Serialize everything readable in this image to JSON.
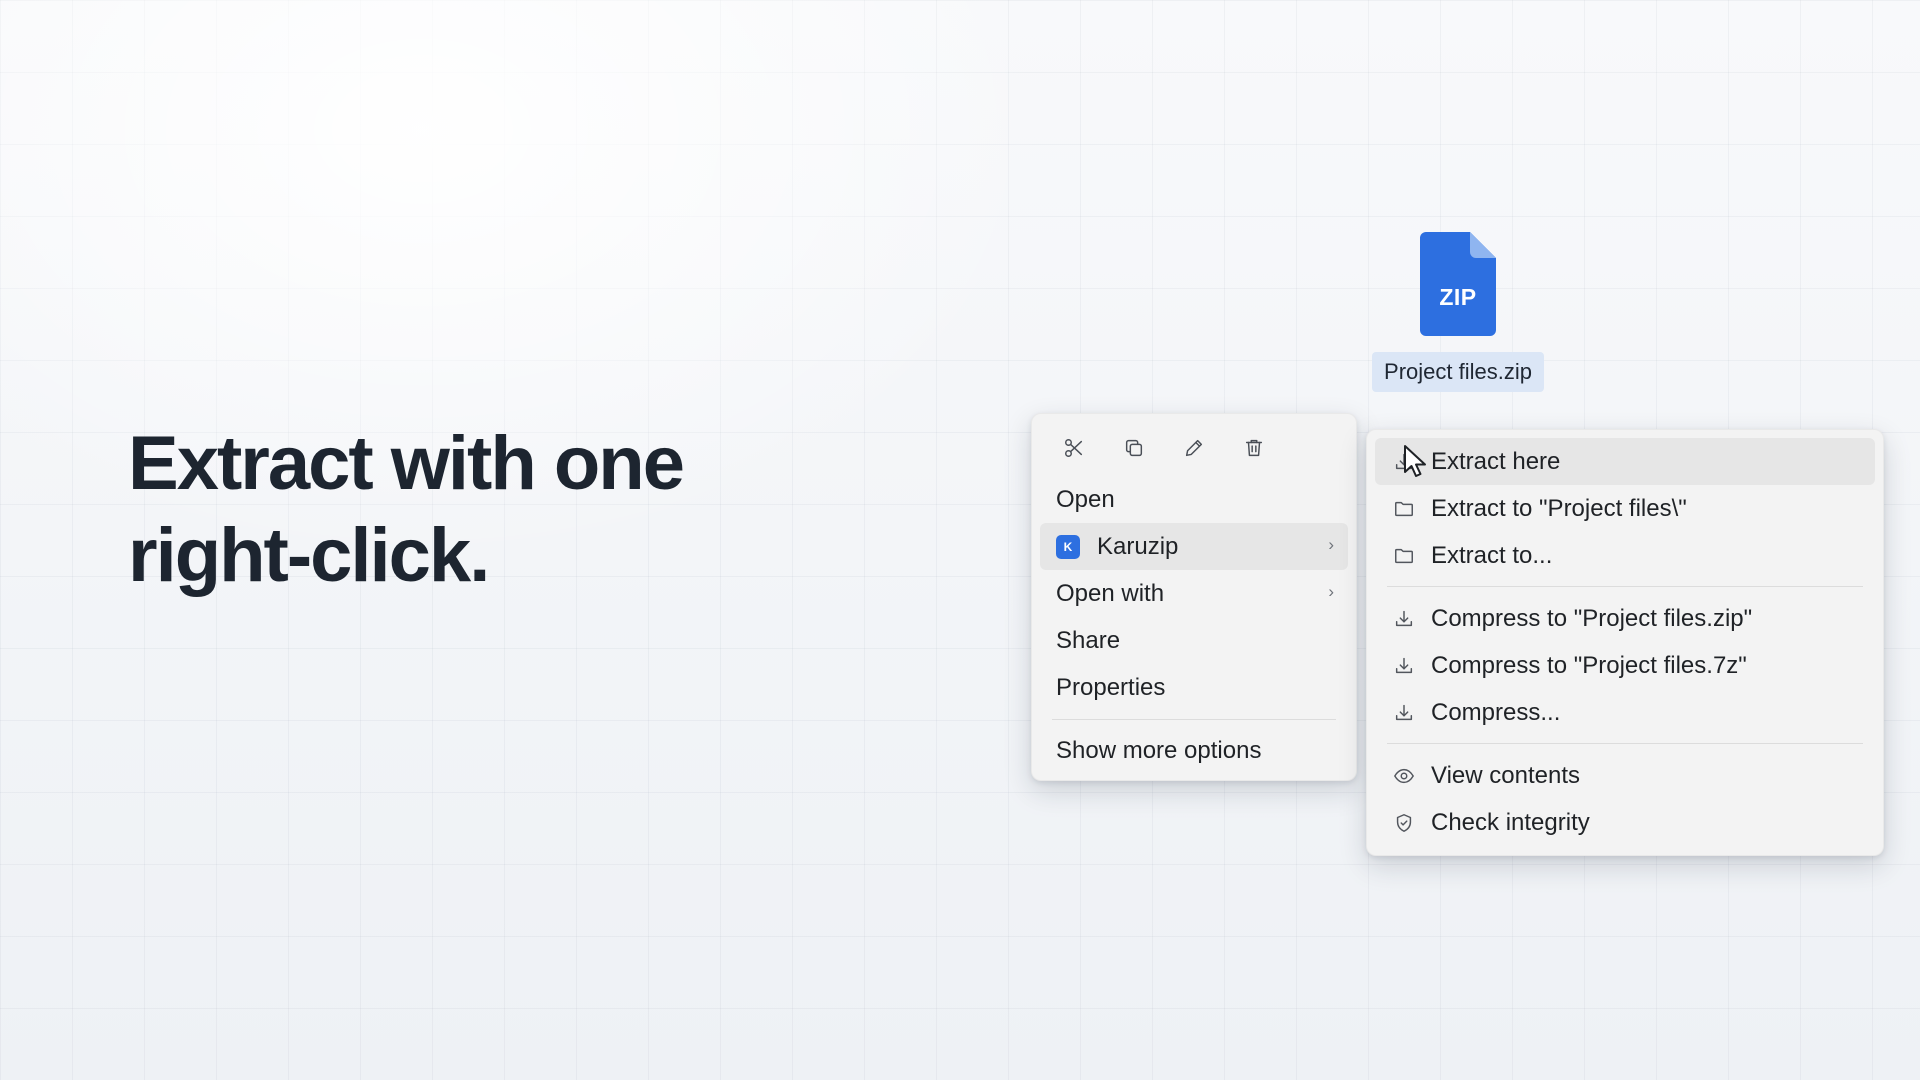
{
  "headline": {
    "line1": "Extract with one",
    "line2": "right-click."
  },
  "file": {
    "badge": "ZIP",
    "name": "Project files.zip",
    "icon": "zip-file-icon",
    "color": "#2d6fe0"
  },
  "context_menu": {
    "toolbar": [
      {
        "name": "cut-button",
        "icon": "scissors-icon"
      },
      {
        "name": "copy-button",
        "icon": "copy-icon"
      },
      {
        "name": "rename-button",
        "icon": "pencil-icon"
      },
      {
        "name": "delete-button",
        "icon": "trash-icon"
      }
    ],
    "items": {
      "open": "Open",
      "karuzip": "Karuzip",
      "karuzip_badge": "K",
      "open_with": "Open with",
      "share": "Share",
      "properties": "Properties",
      "show_more": "Show more options"
    }
  },
  "submenu": {
    "extract_here": "Extract here",
    "extract_to_folder": "Extract to \"Project files\\\"",
    "extract_to": "Extract to...",
    "compress_zip": "Compress to \"Project files.zip\"",
    "compress_7z": "Compress to \"Project files.7z\"",
    "compress": "Compress...",
    "view_contents": "View contents",
    "check_integrity": "Check integrity"
  },
  "colors": {
    "accent": "#2d6fe0",
    "selection": "#dbe6f6",
    "headline": "#1d2530"
  }
}
